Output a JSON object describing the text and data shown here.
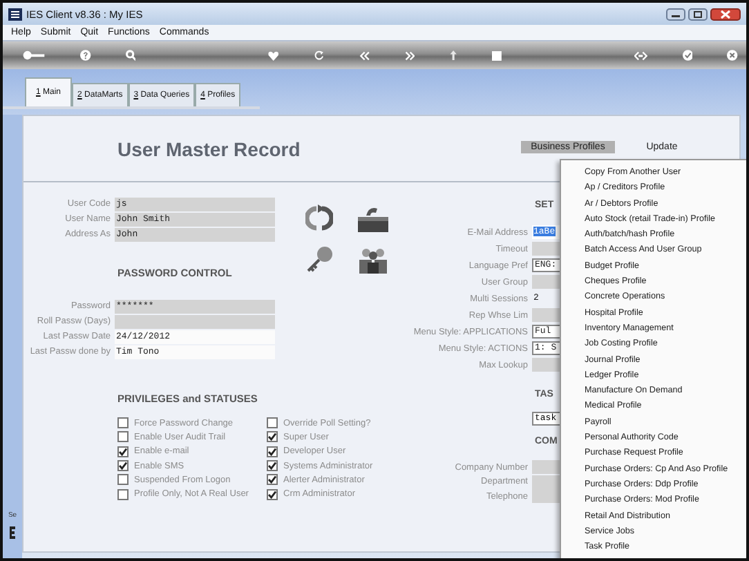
{
  "window": {
    "title": "IES Client v8.36 : My IES"
  },
  "menu_bar": [
    "Help",
    "Submit",
    "Quit",
    "Functions",
    "Commands"
  ],
  "tabs": [
    {
      "label": "1 Main",
      "selected": true
    },
    {
      "label": "2 DataMarts",
      "selected": false
    },
    {
      "label": "3 Data Queries",
      "selected": false
    },
    {
      "label": "4 Profiles",
      "selected": false
    }
  ],
  "heading": "User Master Record",
  "header_buttons": [
    {
      "label": "Business Profiles",
      "selected": true
    },
    {
      "label": "Update",
      "selected": false
    }
  ],
  "user_fields": [
    {
      "label": "User Code",
      "value": "js"
    },
    {
      "label": "User Name",
      "value": "John Smith"
    },
    {
      "label": "Address As",
      "value": "John"
    }
  ],
  "password_section": {
    "title": "PASSWORD CONTROL",
    "fields": [
      {
        "label": "Password",
        "value": "*******",
        "shaded": true
      },
      {
        "label": "Roll Passw (Days)",
        "shaded": true
      },
      {
        "label": "Last Passw Date",
        "value": "24/12/2012",
        "shaded": false
      },
      {
        "label": "Last Passw done by",
        "value": "Tim Tono",
        "shaded": false
      }
    ]
  },
  "privileges": {
    "title": "PRIVILEGES and STATUSES",
    "columns": [
      [
        {
          "label": "Force Password Change",
          "checked": false
        },
        {
          "label": "Enable User Audit Trail",
          "checked": false
        },
        {
          "label": "Enable e-mail",
          "checked": true
        },
        {
          "label": "Enable SMS",
          "checked": true
        },
        {
          "label": "Suspended From Logon",
          "checked": false
        },
        {
          "label": "Profile Only, Not A Real User",
          "checked": false
        }
      ],
      [
        {
          "label": "Override Poll Setting?",
          "checked": false
        },
        {
          "label": "Super User",
          "checked": true
        },
        {
          "label": "Developer User",
          "checked": true
        },
        {
          "label": "Systems Administrator",
          "checked": true
        },
        {
          "label": "Alerter Administrator",
          "checked": true
        },
        {
          "label": "Crm Administrator",
          "checked": true
        }
      ]
    ]
  },
  "settings": {
    "title": "SET",
    "fields": [
      {
        "label": "E-Mail Address",
        "value": "1aBe",
        "kind": "highlight"
      },
      {
        "label": "Timeout",
        "kind": "shaded"
      },
      {
        "label": "Language Pref",
        "value": "ENG:",
        "kind": "box"
      },
      {
        "label": "User Group",
        "kind": "shaded"
      },
      {
        "label": "Multi Sessions",
        "value": "2",
        "kind": "plain"
      },
      {
        "label": "Rep Whse Lim",
        "kind": "shaded"
      },
      {
        "label": "Menu Style: APPLICATIONS",
        "value": "Ful",
        "kind": "box"
      },
      {
        "label": "Menu Style: ACTIONS",
        "value": "1: S",
        "kind": "box"
      },
      {
        "label": "Max Lookup",
        "kind": "shaded"
      }
    ]
  },
  "task_section": {
    "title": "TAS",
    "value": "task"
  },
  "company_section": {
    "title": "COM",
    "fields": [
      {
        "label": "Company Number"
      },
      {
        "label": "Department"
      },
      {
        "label": "Telephone"
      }
    ]
  },
  "side_label": "Se",
  "popup_menu": [
    "Copy From Another User",
    "Ap / Creditors Profile",
    "Ar / Debtors Profile",
    "Auto Stock (retail Trade-in) Profile",
    "Auth/batch/hash Profile",
    "Batch Access And User Group",
    "Budget Profile",
    "Cheques Profile",
    "Concrete Operations",
    "Hospital Profile",
    "Inventory Management",
    "Job Costing Profile",
    "Journal Profile",
    "Ledger Profile",
    "Manufacture On Demand",
    "Medical Profile",
    "Payroll",
    "Personal Authority Code",
    "Purchase Request Profile",
    "Purchase Orders: Cp And Aso Profile",
    "Purchase Orders: Ddp Profile",
    "Purchase Orders: Mod Profile",
    "Retail And Distribution",
    "Service Jobs",
    "Task Profile"
  ]
}
